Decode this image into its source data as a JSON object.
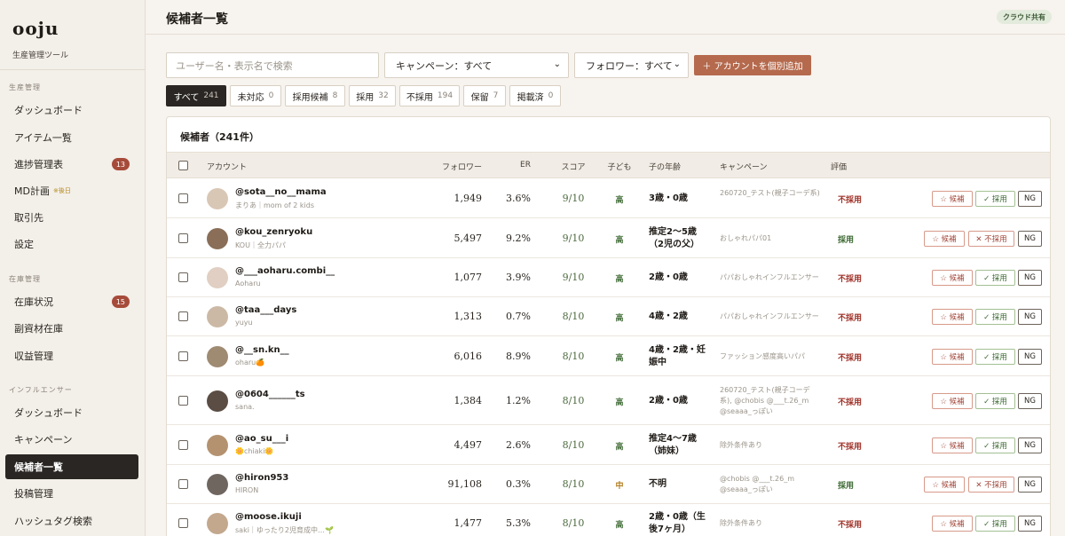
{
  "sidebar": {
    "logo": "ooju",
    "logo_sub": "生産管理ツール",
    "sections": [
      {
        "title": "生産管理",
        "items": [
          {
            "label": "ダッシュボード"
          },
          {
            "label": "アイテム一覧"
          },
          {
            "label": "進捗管理表",
            "badge": "13"
          },
          {
            "label": "MD計画",
            "note": "※後日"
          },
          {
            "label": "取引先"
          },
          {
            "label": "設定"
          }
        ]
      },
      {
        "title": "在庫管理",
        "items": [
          {
            "label": "在庫状況",
            "badge": "15"
          },
          {
            "label": "副資材在庫"
          },
          {
            "label": "収益管理"
          }
        ]
      },
      {
        "title": "インフルエンサー",
        "items": [
          {
            "label": "ダッシュボード"
          },
          {
            "label": "キャンペーン"
          },
          {
            "label": "候補者一覧",
            "active": true
          },
          {
            "label": "投稿管理"
          },
          {
            "label": "ハッシュタグ検索"
          }
        ]
      }
    ]
  },
  "header": {
    "title": "候補者一覧",
    "badge": "クラウド共有"
  },
  "toolbar": {
    "search_placeholder": "ユーザー名・表示名で検索",
    "campaign_select": "キャンペーン：すべて",
    "follower_select": "フォロワー：すべて",
    "add_button": "＋ アカウントを個別追加"
  },
  "filters": [
    {
      "label": "すべて",
      "count": "241",
      "active": true
    },
    {
      "label": "未対応",
      "count": "0"
    },
    {
      "label": "採用候補",
      "count": "8"
    },
    {
      "label": "採用",
      "count": "32"
    },
    {
      "label": "不採用",
      "count": "194"
    },
    {
      "label": "保留",
      "count": "7"
    },
    {
      "label": "掲載済",
      "count": "0"
    }
  ],
  "table": {
    "title": "候補者（241件）",
    "columns": {
      "account": "アカウント",
      "followers": "フォロワー",
      "er": "ER",
      "score": "スコア",
      "kids": "子ども",
      "kid_age": "子の年齢",
      "campaign": "キャンペーン",
      "evaluation": "評価"
    },
    "action_labels": {
      "candidate": "☆ 候補",
      "adopt": "✓ 採用",
      "reject": "✕ 不採用",
      "ng": "NG"
    },
    "rows": [
      {
        "handle": "@sota__no__mama",
        "sub": "まりあ｜mom of 2 kids",
        "followers": "1,949",
        "er": "3.6%",
        "score": "9/10",
        "kids": "高",
        "age": "3歳・0歳",
        "campaign": "260720_テスト(親子コーデ系)",
        "eval": "不採用",
        "eval_type": "ng",
        "avatar": "#d9c7b5"
      },
      {
        "handle": "@kou_zenryoku",
        "sub": "KOU｜全力パパ",
        "followers": "5,497",
        "er": "9.2%",
        "score": "9/10",
        "kids": "高",
        "age": "推定2〜5歳（2児の父）",
        "campaign": "おしゃれパパ01",
        "eval": "採用",
        "eval_type": "ok",
        "avatar": "#8a6e58"
      },
      {
        "handle": "@___aoharu.combi__",
        "sub": "Aoharu",
        "followers": "1,077",
        "er": "3.9%",
        "score": "9/10",
        "kids": "高",
        "age": "2歳・0歳",
        "campaign": "パパおしゃれインフルエンサー",
        "eval": "不採用",
        "eval_type": "ng",
        "avatar": "#e0cfc2"
      },
      {
        "handle": "@taa___days",
        "sub": "yuyu",
        "followers": "1,313",
        "er": "0.7%",
        "score": "8/10",
        "kids": "高",
        "age": "4歳・2歳",
        "campaign": "パパおしゃれインフルエンサー",
        "eval": "不採用",
        "eval_type": "ng",
        "avatar": "#cbb9a6"
      },
      {
        "handle": "@__sn.kn__",
        "sub": "oharu🍊",
        "followers": "6,016",
        "er": "8.9%",
        "score": "8/10",
        "kids": "高",
        "age": "4歳・2歳・妊娠中",
        "campaign": "ファッション感度高いパパ",
        "eval": "不採用",
        "eval_type": "ng",
        "avatar": "#9f8a72"
      },
      {
        "handle": "@0604______ts",
        "sub": "sana.",
        "followers": "1,384",
        "er": "1.2%",
        "score": "8/10",
        "kids": "高",
        "age": "2歳・0歳",
        "campaign": "260720_テスト(親子コーデ系), @chobis @___t.26_m @seaaa_っぽい",
        "eval": "不採用",
        "eval_type": "ng",
        "avatar": "#5b4d44"
      },
      {
        "handle": "@ao_su___i",
        "sub": "🌼chiaki🌼",
        "followers": "4,497",
        "er": "2.6%",
        "score": "8/10",
        "kids": "高",
        "age": "推定4〜7歳（姉妹）",
        "campaign": "除外条件あり",
        "eval": "不採用",
        "eval_type": "ng",
        "avatar": "#b49270"
      },
      {
        "handle": "@hiron953",
        "sub": "HIRON",
        "followers": "91,108",
        "er": "0.3%",
        "score": "8/10",
        "kids": "中",
        "age": "不明",
        "campaign": "@chobis @___t.26_m @seaaa_っぽい",
        "eval": "採用",
        "eval_type": "ok",
        "avatar": "#6f6660"
      },
      {
        "handle": "@moose.ikuji",
        "sub": "saki｜ゆったり2児育成中…🌱",
        "followers": "1,477",
        "er": "5.3%",
        "score": "8/10",
        "kids": "高",
        "age": "2歳・0歳（生後7ヶ月）",
        "campaign": "除外条件あり",
        "eval": "不採用",
        "eval_type": "ng",
        "avatar": "#c3a88d"
      }
    ]
  }
}
